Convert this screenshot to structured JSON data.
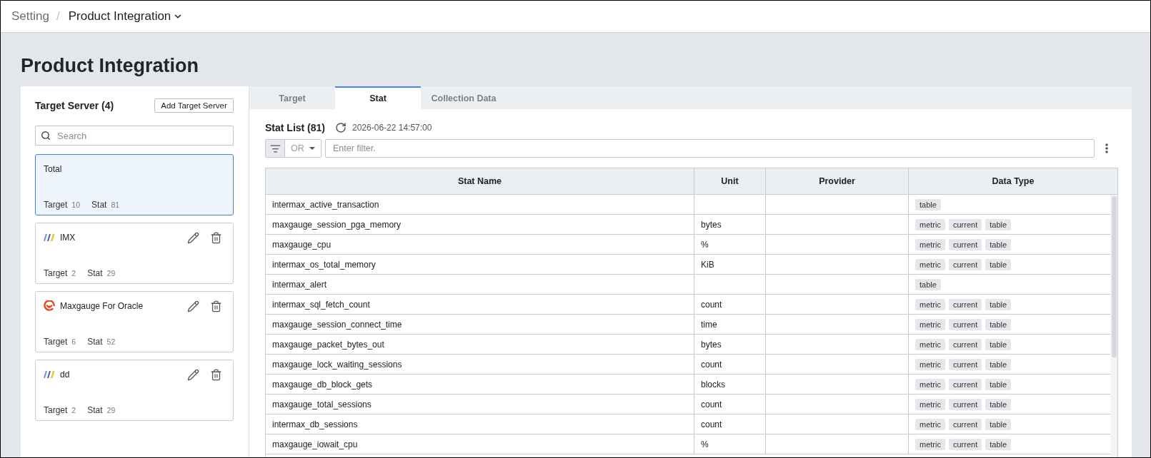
{
  "breadcrumb": {
    "parent": "Setting",
    "separator": "/",
    "current": "Product Integration"
  },
  "page_title": "Product Integration",
  "target_servers": {
    "title": "Target Server (4)",
    "add_button": "Add Target Server",
    "search": {
      "placeholder": "Search"
    },
    "items": [
      {
        "kind": "summary",
        "name": "Total",
        "target_label": "Target",
        "target_count": "10",
        "stat_label": "Stat",
        "stat_count": "81",
        "selected": true
      },
      {
        "kind": "stripes",
        "name": "IMX",
        "target_label": "Target",
        "target_count": "2",
        "stat_label": "Stat",
        "stat_count": "29",
        "selected": false
      },
      {
        "kind": "swirl",
        "name": "Maxgauge For Oracle",
        "target_label": "Target",
        "target_count": "6",
        "stat_label": "Stat",
        "stat_count": "52",
        "selected": false
      },
      {
        "kind": "stripes",
        "name": "dd",
        "target_label": "Target",
        "target_count": "2",
        "stat_label": "Stat",
        "stat_count": "29",
        "selected": false
      }
    ]
  },
  "tabs": [
    {
      "label": "Target",
      "selected": false
    },
    {
      "label": "Stat",
      "selected": true
    },
    {
      "label": "Collection Data",
      "selected": false
    }
  ],
  "stat_list": {
    "title": "Stat List (81)",
    "timestamp": "2026-06-22 14:57:00",
    "filter": {
      "operator": "OR",
      "placeholder": "Enter filter."
    },
    "table": {
      "columns": [
        "Stat Name",
        "Unit",
        "Provider",
        "Data Type"
      ],
      "rows": [
        {
          "stat_name": "intermax_active_transaction",
          "data_types": [
            "table"
          ]
        },
        {
          "stat_name": "maxgauge_session_pga_memory",
          "unit": "bytes",
          "data_types": [
            "metric",
            "current",
            "table"
          ]
        },
        {
          "stat_name": "maxgauge_cpu",
          "unit": "%",
          "data_types": [
            "metric",
            "current",
            "table"
          ]
        },
        {
          "stat_name": "intermax_os_total_memory",
          "unit": "KiB",
          "data_types": [
            "metric",
            "current",
            "table"
          ]
        },
        {
          "stat_name": "intermax_alert",
          "data_types": [
            "table"
          ]
        },
        {
          "stat_name": "intermax_sql_fetch_count",
          "unit": "count",
          "data_types": [
            "metric",
            "current",
            "table"
          ]
        },
        {
          "stat_name": "maxgauge_session_connect_time",
          "unit": "time",
          "data_types": [
            "metric",
            "current",
            "table"
          ]
        },
        {
          "stat_name": "maxgauge_packet_bytes_out",
          "unit": "bytes",
          "data_types": [
            "metric",
            "current",
            "table"
          ]
        },
        {
          "stat_name": "maxgauge_lock_waiting_sessions",
          "unit": "count",
          "data_types": [
            "metric",
            "current",
            "table"
          ]
        },
        {
          "stat_name": "maxgauge_db_block_gets",
          "unit": "blocks",
          "data_types": [
            "metric",
            "current",
            "table"
          ]
        },
        {
          "stat_name": "maxgauge_total_sessions",
          "unit": "count",
          "data_types": [
            "metric",
            "current",
            "table"
          ]
        },
        {
          "stat_name": "intermax_db_sessions",
          "unit": "count",
          "data_types": [
            "metric",
            "current",
            "table"
          ]
        },
        {
          "stat_name": "maxgauge_iowait_cpu",
          "unit": "%",
          "data_types": [
            "metric",
            "current",
            "table"
          ]
        }
      ]
    }
  }
}
